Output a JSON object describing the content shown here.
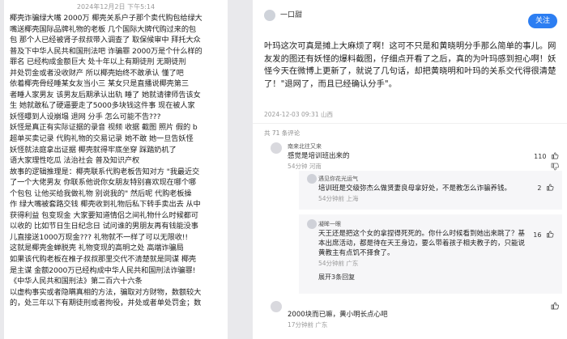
{
  "left": {
    "date": "2024年12月2日 下午5:14",
    "lines": [
      "椰壳诈骗绿大嘴 2000万 椰壳关系户子那个卖代购包给绿大",
      "嘴送椰壳国际品牌礼物的老板 几个国际大牌代购过来的包",
      "包 那个人已经被肾子叔叔带入调查了 取保候审中 拜托大众",
      "普及下中华人民共和国刑法吧 诈骗罪 2000万是个什么样的",
      "罪名 已经构成金额巨大 处十年以上有期徒刑 无期徒刑",
      "并处罚金或者没收财产 所以椰壳始终不敢承认 懂了吧",
      "依着椰壳骨经睡某女友当小三 某女只是直播说椰壳第三",
      "者睡人家男友 该男友后期承认出轨 睡了 她就请律师告该女",
      "生 她就敢私了硬逼要走了5000多块钱这件事 现在被人家",
      "妖怪曝到人设崩塌 退网 分手 怎么可能不告???",
      "妖怪是真正有实际证据的录音 视频 收据 截图 照片 假的 b",
      "超单买卖记录 代购礼物的交易记录 她不敢 她一旦告妖怪",
      "妖怪就法庭拿出证据 椰壳就得牢底坐穿 踩踏奶机了",
      "语大家理性吃瓜 法治社会 普及知识产权",
      "故事的逻辑推理是：椰壳联系代购老板告知对方 \"我最近交",
      "了一个大佬男友 你联系他说你女朋友特别喜欢现在哪个哪",
      "个包包 让他买给我做礼物 别说我的\" 然后呢 代购老板操",
      "作 绿大嘴被套路交钱 椰壳收到礼物后私下转手卖出去 从中",
      "获得利益 包变现金 大家要知道情侣之间礼物什么时候都可",
      "以收的 比如节日生日纪念日 试问谁的男朋友再有钱能没事",
      "儿直接送1000万现金??? 礼物就不一样了可以无限收!!",
      "这就是椰壳金蝉脱壳 礼物变现的高明之处 高端诈骗局",
      "如果该代购老板在椎子叔叔那里交代不清楚就是同谋 椰壳",
      "是主谋 金额2000万已经构成中华人民共和国刑法诈骗罪!",
      "《中华人民共和国刑法》第二百六十六条",
      "以虚构事实或者隐瞒真相的方法，骗取对方财物，数额较大",
      "的，处三年以下有期徒刑或者拘役，并处或者单处罚金；数"
    ]
  },
  "post": {
    "author": "一口甜",
    "follow_label": "关注",
    "body": "叶玛这次可真是摊上大麻烦了啊！这可不只是和黄晓明分手那么简单的事儿。网友发的图还有妖怪的爆料截图，仔细点开看了之后，真的为叶玛感到担心啊！妖怪今天在微博上更新了，就说了几句话，却把黄晓明和叶玛的关系交代得很清楚了！\"退网了，而且已经确认分手\"。",
    "meta": "2024-12-03 09:31 山西",
    "comment_count": "共 71 条评论"
  },
  "comments": [
    {
      "name": "南来北往又来",
      "text": "感觉是培训班出来的",
      "meta": "54分钟 河南",
      "likes": "110",
      "replies": [
        {
          "name": "遇见你花光运气",
          "text": "培训班是交级弥杰么做贤妻良母拿好处，不是教怎么诈骗养钱。",
          "meta": "54分钟前 上海",
          "likes": "2"
        }
      ]
    },
    {
      "name": "凝眸一眼",
      "text": "天王还是把这个女的拿捏得死死的。你什么时候看到她出来跳了？基本出席活动，都是待在天王身边，要么带着孩子相夫教子的，只能说黄教主有点饥不择食了。",
      "meta": "54分钟前 广东",
      "likes": "16",
      "more": "展开3条回复"
    },
    {
      "name": "",
      "text": "2000块而已嘛，黄小明长点心吧",
      "meta": "17分钟前 广东",
      "likes": ""
    }
  ],
  "colors": {
    "accent": "#2c7ef2",
    "highlight": "#f5f0a8",
    "underline": "#c0392b"
  }
}
